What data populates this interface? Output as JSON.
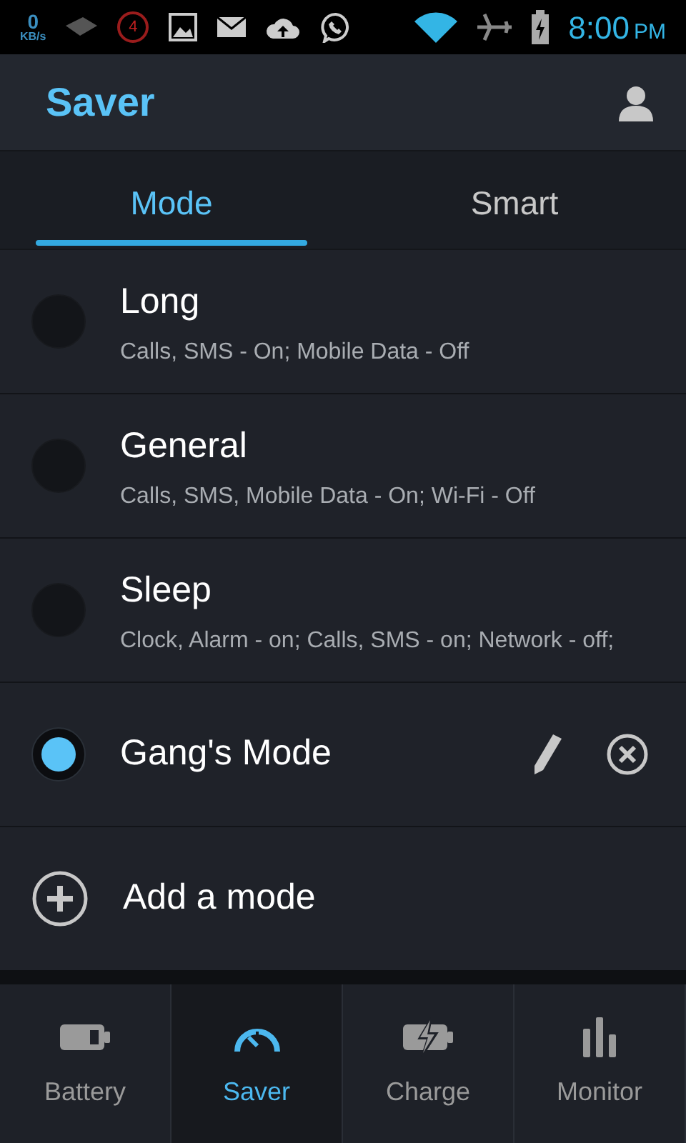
{
  "status_bar": {
    "speed_value": "0",
    "speed_unit": "KB/s",
    "notification_count": "4",
    "time": "8:00",
    "ampm": "PM"
  },
  "header": {
    "title": "Saver"
  },
  "tabs": [
    {
      "label": "Mode",
      "selected": true
    },
    {
      "label": "Smart",
      "selected": false
    }
  ],
  "modes": [
    {
      "name": "Long",
      "description": "Calls, SMS - On; Mobile Data - Off",
      "selected": false,
      "kind": "preset"
    },
    {
      "name": "General",
      "description": "Calls, SMS, Mobile Data - On; Wi-Fi - Off",
      "selected": false,
      "kind": "preset"
    },
    {
      "name": "Sleep",
      "description": "Clock, Alarm - on; Calls, SMS - on; Network - off;",
      "selected": false,
      "kind": "preset"
    },
    {
      "name": "Gang's Mode",
      "selected": true,
      "kind": "custom"
    }
  ],
  "add_mode": {
    "label": "Add a mode"
  },
  "bottom_nav": [
    {
      "label": "Battery",
      "selected": false,
      "kind": "battery"
    },
    {
      "label": "Saver",
      "selected": true,
      "kind": "gauge"
    },
    {
      "label": "Charge",
      "selected": false,
      "kind": "charge"
    },
    {
      "label": "Monitor",
      "selected": false,
      "kind": "bars"
    }
  ]
}
